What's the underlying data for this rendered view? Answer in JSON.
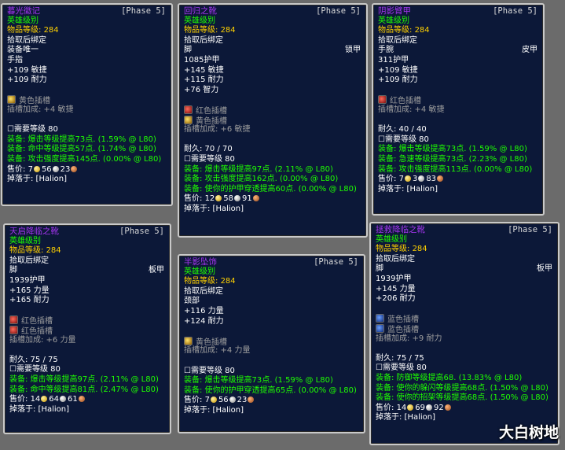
{
  "cards": [
    {
      "name": "暮光徽记",
      "phase": "[Phase 5]",
      "lines": [
        {
          "t": "英雄级别",
          "c": "green"
        },
        {
          "t": "物品等级: ",
          "v": "284",
          "c": "ilvl"
        },
        {
          "t": "拾取后绑定",
          "c": "white"
        },
        {
          "t": "装备唯一",
          "c": "white"
        },
        {
          "t": "手指",
          "c": "white"
        },
        {
          "t": "+109 敏捷",
          "c": "white"
        },
        {
          "t": "+109 耐力",
          "c": "white"
        },
        {
          "gap": true
        },
        {
          "socket": "yellow",
          "t": "黄色插槽",
          "c": "grey"
        },
        {
          "t": "插槽加成: +4 敏捷",
          "c": "grey"
        },
        {
          "gap": true
        },
        {
          "t": "需要等级 80",
          "c": "white"
        },
        {
          "t": "装备: 爆击等级提高73点.  (1.59% @ L80)",
          "c": "green"
        },
        {
          "t": "装备: 命中等级提高57点.  (1.74% @ L80)",
          "c": "green"
        },
        {
          "t": "装备: 攻击强度提高145点.  (0.00% @ L80)",
          "c": "green"
        },
        {
          "price": true,
          "g": "7",
          "s": "56",
          "cp": "23"
        },
        {
          "t": "掉落于: [Halion]",
          "c": "white"
        }
      ]
    },
    {
      "name": "回归之靴",
      "phase": "[Phase 5]",
      "lines": [
        {
          "t": "英雄级别",
          "c": "green"
        },
        {
          "t": "物品等级: ",
          "v": "284",
          "c": "ilvl"
        },
        {
          "t": "拾取后绑定",
          "c": "white"
        },
        {
          "t": "脚",
          "r": "锁甲",
          "c": "white"
        },
        {
          "t": "1085护甲",
          "c": "white"
        },
        {
          "t": "+145 敏捷",
          "c": "white"
        },
        {
          "t": "+115 耐力",
          "c": "white"
        },
        {
          "t": "+76 智力",
          "c": "white"
        },
        {
          "gap": true
        },
        {
          "socket": "red",
          "t": "红色插槽",
          "c": "grey"
        },
        {
          "socket": "yellow",
          "t": "黄色插槽",
          "c": "grey"
        },
        {
          "t": "插槽加成: +6 敏捷",
          "c": "grey"
        },
        {
          "gap": true
        },
        {
          "t": "耐久: 70 / 70",
          "c": "white"
        },
        {
          "t": "需要等级 80",
          "c": "white"
        },
        {
          "t": "装备: 爆击等级提高97点.  (2.11% @ L80)",
          "c": "green"
        },
        {
          "t": "装备: 攻击强度提高162点.  (0.00% @ L80)",
          "c": "green"
        },
        {
          "t": "装备: 使你的护甲穿透提高60点.  (0.00% @ L80)",
          "c": "green"
        },
        {
          "price": true,
          "g": "12",
          "s": "58",
          "cp": "91"
        },
        {
          "t": "掉落于: [Halion]",
          "c": "white"
        }
      ]
    },
    {
      "name": "阴影臂甲",
      "phase": "[Phase 5]",
      "lines": [
        {
          "t": "英雄级别",
          "c": "green"
        },
        {
          "t": "物品等级: ",
          "v": "284",
          "c": "ilvl"
        },
        {
          "t": "拾取后绑定",
          "c": "white"
        },
        {
          "t": "手腕",
          "r": "皮甲",
          "c": "white"
        },
        {
          "t": "311护甲",
          "c": "white"
        },
        {
          "t": "+109 敏捷",
          "c": "white"
        },
        {
          "t": "+109 耐力",
          "c": "white"
        },
        {
          "gap": true
        },
        {
          "socket": "red",
          "t": "红色插槽",
          "c": "grey"
        },
        {
          "t": "插槽加成: +4 敏捷",
          "c": "grey"
        },
        {
          "gap": true
        },
        {
          "t": "耐久: 40 / 40",
          "c": "white"
        },
        {
          "t": "需要等级 80",
          "c": "white"
        },
        {
          "t": "装备: 爆击等级提高73点.  (1.59% @ L80)",
          "c": "green"
        },
        {
          "t": "装备: 急速等级提高73点.  (2.23% @ L80)",
          "c": "green"
        },
        {
          "t": "装备: 攻击强度提高113点.  (0.00% @ L80)",
          "c": "green"
        },
        {
          "price": true,
          "g": "7",
          "s": "3",
          "cp": "83"
        },
        {
          "t": "掉落于: [Halion]",
          "c": "white"
        }
      ]
    },
    {
      "name": "天启降临之靴",
      "phase": "[Phase 5]",
      "lines": [
        {
          "t": "英雄级别",
          "c": "green"
        },
        {
          "t": "物品等级: ",
          "v": "284",
          "c": "ilvl"
        },
        {
          "t": "拾取后绑定",
          "c": "white"
        },
        {
          "t": "脚",
          "r": "板甲",
          "c": "white"
        },
        {
          "t": "1939护甲",
          "c": "white"
        },
        {
          "t": "+165 力量",
          "c": "white"
        },
        {
          "t": "+165 耐力",
          "c": "white"
        },
        {
          "gap": true
        },
        {
          "socket": "red",
          "t": "红色插槽",
          "c": "grey"
        },
        {
          "socket": "red",
          "t": "红色插槽",
          "c": "grey"
        },
        {
          "t": "插槽加成: +6 力量",
          "c": "grey"
        },
        {
          "gap": true
        },
        {
          "t": "耐久: 75 / 75",
          "c": "white"
        },
        {
          "t": "需要等级 80",
          "c": "white"
        },
        {
          "t": "装备: 爆击等级提高97点.  (2.11% @ L80)",
          "c": "green"
        },
        {
          "t": "装备: 命中等级提高81点.  (2.47% @ L80)",
          "c": "green"
        },
        {
          "price": true,
          "g": "14",
          "s": "64",
          "cp": "61"
        },
        {
          "t": "掉落于: [Halion]",
          "c": "white"
        }
      ]
    },
    {
      "name": "半影坠饰",
      "phase": "[Phase 5]",
      "lines": [
        {
          "t": "英雄级别",
          "c": "green"
        },
        {
          "t": "物品等级: ",
          "v": "284",
          "c": "ilvl"
        },
        {
          "t": "拾取后绑定",
          "c": "white"
        },
        {
          "t": "颈部",
          "c": "white"
        },
        {
          "t": "+116 力量",
          "c": "white"
        },
        {
          "t": "+124 耐力",
          "c": "white"
        },
        {
          "gap": true
        },
        {
          "socket": "yellow",
          "t": "黄色插槽",
          "c": "grey"
        },
        {
          "t": "插槽加成: +4 力量",
          "c": "grey"
        },
        {
          "gap": true
        },
        {
          "t": "需要等级 80",
          "c": "white"
        },
        {
          "t": "装备: 爆击等级提高73点.  (1.59% @ L80)",
          "c": "green"
        },
        {
          "t": "装备: 使你的护甲穿透提高65点.  (0.00% @ L80)",
          "c": "green"
        },
        {
          "price": true,
          "g": "7",
          "s": "56",
          "cp": "23"
        },
        {
          "t": "掉落于: [Halion]",
          "c": "white"
        }
      ]
    },
    {
      "name": "拯救降临之靴",
      "phase": "[Phase 5]",
      "lines": [
        {
          "t": "英雄级别",
          "c": "green"
        },
        {
          "t": "物品等级: ",
          "v": "284",
          "c": "ilvl"
        },
        {
          "t": "拾取后绑定",
          "c": "white"
        },
        {
          "t": "脚",
          "r": "板甲",
          "c": "white"
        },
        {
          "t": "1939护甲",
          "c": "white"
        },
        {
          "t": "+145 力量",
          "c": "white"
        },
        {
          "t": "+206 耐力",
          "c": "white"
        },
        {
          "gap": true
        },
        {
          "socket": "blue",
          "t": "蓝色插槽",
          "c": "grey"
        },
        {
          "socket": "blue",
          "t": "蓝色插槽",
          "c": "grey"
        },
        {
          "t": "插槽加成: +9 耐力",
          "c": "grey"
        },
        {
          "gap": true
        },
        {
          "t": "耐久: 75 / 75",
          "c": "white"
        },
        {
          "t": "需要等级 80",
          "c": "white"
        },
        {
          "t": "装备: 防御等级提高68.  (13.83% @ L80)",
          "c": "green"
        },
        {
          "t": "装备: 使你的躲闪等级提高68点.  (1.50% @ L80)",
          "c": "green"
        },
        {
          "t": "装备: 使你的招架等级提高68点.  (1.50% @ L80)",
          "c": "green"
        },
        {
          "price": true,
          "g": "14",
          "s": "69",
          "cp": "92"
        },
        {
          "t": "掉落于: [Halion]",
          "c": "white"
        }
      ]
    }
  ],
  "price_label": "售价: ",
  "required_prefix_icon": "checkbox-icon",
  "watermark": "大白树地"
}
